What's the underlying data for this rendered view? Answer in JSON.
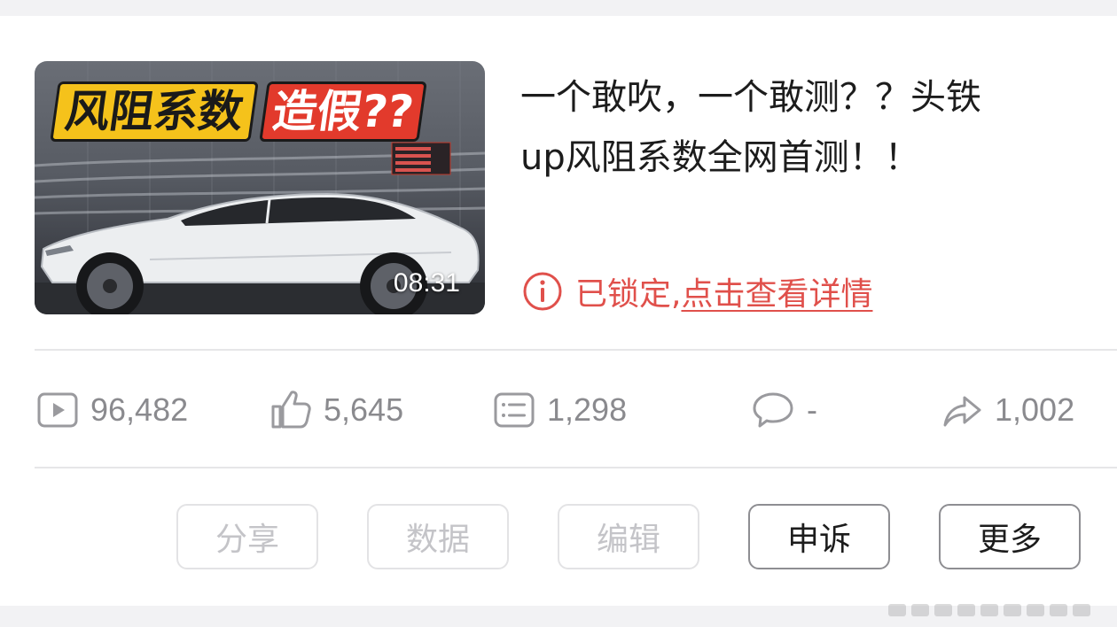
{
  "video": {
    "thumbnail": {
      "headline_part1": "风阻系数",
      "headline_part2": "造假??",
      "duration": "08:31"
    },
    "title_line1": "一个敢吹，一个敢测？？头铁",
    "title_line2": "up风阻系数全网首测！！",
    "status": {
      "prefix": "已锁定,",
      "link": "点击查看详情",
      "color": "#e0504b"
    }
  },
  "stats": {
    "plays": "96,482",
    "likes": "5,645",
    "danmaku": "1,298",
    "comments": "-",
    "shares": "1,002"
  },
  "actions": {
    "share": "分享",
    "data": "数据",
    "edit": "编辑",
    "appeal": "申诉",
    "more": "更多"
  },
  "icons": [
    "play-icon",
    "thumbs-up-icon",
    "danmaku-icon",
    "comment-icon",
    "share-arrow-icon",
    "info-icon"
  ]
}
